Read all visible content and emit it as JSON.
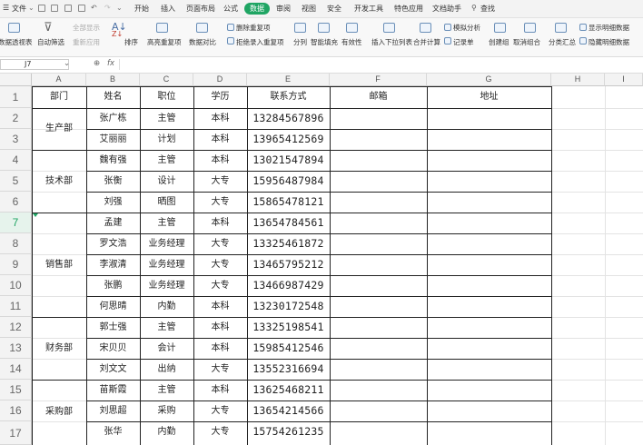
{
  "menubar": {
    "file": "文件",
    "tabs": [
      "开始",
      "插入",
      "页面布局",
      "公式",
      "数据",
      "审阅",
      "视图",
      "安全",
      "开发工具",
      "特色应用",
      "文档助手"
    ],
    "active_tab": "数据",
    "search": "查找"
  },
  "ribbon": {
    "pivot": "数据透视表",
    "filter_all": "全部显示",
    "reapply": "重新应用",
    "auto_filter": "自动筛选",
    "sort": "排序",
    "highlight_dup": "高亮重复项",
    "compare": "数据对比",
    "remove_dup": "删除重复项",
    "reject_dup": "拒绝录入重复项",
    "split": "分列",
    "smart_fill": "智能填充",
    "validity": "有效性",
    "insert_dropdown": "插入下拉列表",
    "consolidate": "合并计算",
    "simulate": "模拟分析",
    "record": "记录单",
    "group": "创建组",
    "ungroup": "取消组合",
    "subtotal": "分类汇总",
    "show_detail": "显示明细数据",
    "hide_detail": "隐藏明细数据"
  },
  "formula_bar": {
    "cell_ref": "J7",
    "fx": "fx",
    "value": ""
  },
  "columns": [
    "A",
    "B",
    "C",
    "D",
    "E",
    "F",
    "G",
    "H",
    "I"
  ],
  "rows": [
    "1",
    "2",
    "3",
    "4",
    "5",
    "6",
    "7",
    "8",
    "9",
    "10",
    "11",
    "12",
    "13",
    "14",
    "15",
    "16",
    "17"
  ],
  "selected_row": "7",
  "sheet": {
    "headers": [
      "部门",
      "姓名",
      "职位",
      "学历",
      "联系方式",
      "邮箱",
      "地址"
    ],
    "departments": [
      "生产部",
      "技术部",
      "销售部",
      "财务部",
      "采购部"
    ],
    "records": [
      {
        "name": "张广栋",
        "position": "主管",
        "education": "本科",
        "phone": "13284567896"
      },
      {
        "name": "艾丽丽",
        "position": "计划",
        "education": "本科",
        "phone": "13965412569"
      },
      {
        "name": "魏有强",
        "position": "主管",
        "education": "本科",
        "phone": "13021547894"
      },
      {
        "name": "张衡",
        "position": "设计",
        "education": "大专",
        "phone": "15956487984"
      },
      {
        "name": "刘强",
        "position": "晒图",
        "education": "大专",
        "phone": "15865478121"
      },
      {
        "name": "孟建",
        "position": "主管",
        "education": "本科",
        "phone": "13654784561"
      },
      {
        "name": "罗文浩",
        "position": "业务经理",
        "education": "大专",
        "phone": "13325461872"
      },
      {
        "name": "李淑清",
        "position": "业务经理",
        "education": "大专",
        "phone": "13465795212"
      },
      {
        "name": "张鹏",
        "position": "业务经理",
        "education": "大专",
        "phone": "13466987429"
      },
      {
        "name": "何思晴",
        "position": "内勤",
        "education": "本科",
        "phone": "13230172548"
      },
      {
        "name": "郭士强",
        "position": "主管",
        "education": "本科",
        "phone": "13325198541"
      },
      {
        "name": "宋贝贝",
        "position": "会计",
        "education": "本科",
        "phone": "15985412546"
      },
      {
        "name": "刘文文",
        "position": "出纳",
        "education": "大专",
        "phone": "13552316694"
      },
      {
        "name": "苗斯霞",
        "position": "主管",
        "education": "本科",
        "phone": "13625468211"
      },
      {
        "name": "刘思超",
        "position": "采购",
        "education": "大专",
        "phone": "13654214566"
      },
      {
        "name": "张华",
        "position": "内勤",
        "education": "大专",
        "phone": "15754261235"
      }
    ]
  }
}
